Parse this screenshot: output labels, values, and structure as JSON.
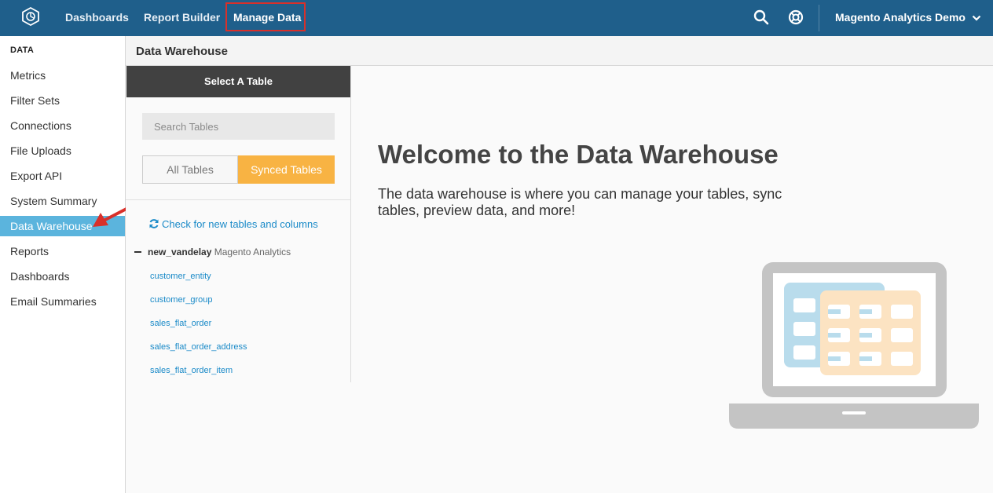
{
  "topbar": {
    "nav": [
      "Dashboards",
      "Report Builder",
      "Manage Data"
    ],
    "active_nav": "Manage Data",
    "account_label": "Magento Analytics Demo",
    "icons": [
      "logo-icon",
      "search-icon",
      "help-icon",
      "chevron-down-icon"
    ]
  },
  "sidebar": {
    "heading": "DATA",
    "items": [
      {
        "label": "Metrics"
      },
      {
        "label": "Filter Sets"
      },
      {
        "label": "Connections"
      },
      {
        "label": "File Uploads"
      },
      {
        "label": "Export API"
      },
      {
        "label": "System Summary"
      },
      {
        "label": "Data Warehouse"
      },
      {
        "label": "Reports"
      },
      {
        "label": "Dashboards"
      },
      {
        "label": "Email Summaries"
      }
    ],
    "active_item": "Data Warehouse"
  },
  "page": {
    "title": "Data Warehouse"
  },
  "table_panel": {
    "header": "Select A Table",
    "search_placeholder": "Search Tables",
    "tabs": [
      "All Tables",
      "Synced Tables"
    ],
    "active_tab": "Synced Tables",
    "check_link": "Check for new tables and columns",
    "database": {
      "name": "new_vandelay",
      "source": "Magento Analytics",
      "tables": [
        "customer_entity",
        "customer_group",
        "sales_flat_order",
        "sales_flat_order_address",
        "sales_flat_order_item"
      ]
    }
  },
  "welcome": {
    "title": "Welcome to the Data Warehouse",
    "text": "The data warehouse is where you can manage your tables, sync tables, preview data, and more!"
  },
  "colors": {
    "topbar": "#1f5f8b",
    "sidebar_active": "#5bb4dd",
    "tab_active": "#f8b343",
    "link": "#1a8ac8",
    "annotation": "#d9302a"
  }
}
